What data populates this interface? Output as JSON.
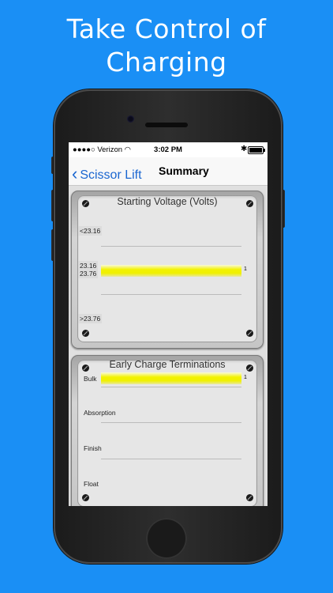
{
  "headline": {
    "line1": "Take Control of",
    "line2": "Charging"
  },
  "status_bar": {
    "carrier": "●●●●○ Verizon",
    "wifi_icon": "wifi-icon",
    "time": "3:02 PM",
    "bluetooth_icon": "bluetooth-icon",
    "battery_icon": "battery-icon"
  },
  "nav": {
    "back_label": "Scissor Lift",
    "title": "Summary"
  },
  "panels": [
    {
      "title": "Starting Voltage (Volts)",
      "rows": [
        {
          "label": "<23.16",
          "value": 0
        },
        {
          "label": "23.16\n23.76",
          "value": 1,
          "count": "1"
        },
        {
          "label": ">23.76",
          "value": 0
        }
      ]
    },
    {
      "title": "Early Charge Terminations",
      "rows": [
        {
          "label": "Bulk",
          "value": 1,
          "count": "1"
        },
        {
          "label": "Absorption",
          "value": 0
        },
        {
          "label": "Finish",
          "value": 0
        },
        {
          "label": "Float",
          "value": 0
        }
      ]
    }
  ],
  "colors": {
    "background": "#1a8ff5",
    "accent": "#1a66d0",
    "bar": "#f0f000"
  }
}
